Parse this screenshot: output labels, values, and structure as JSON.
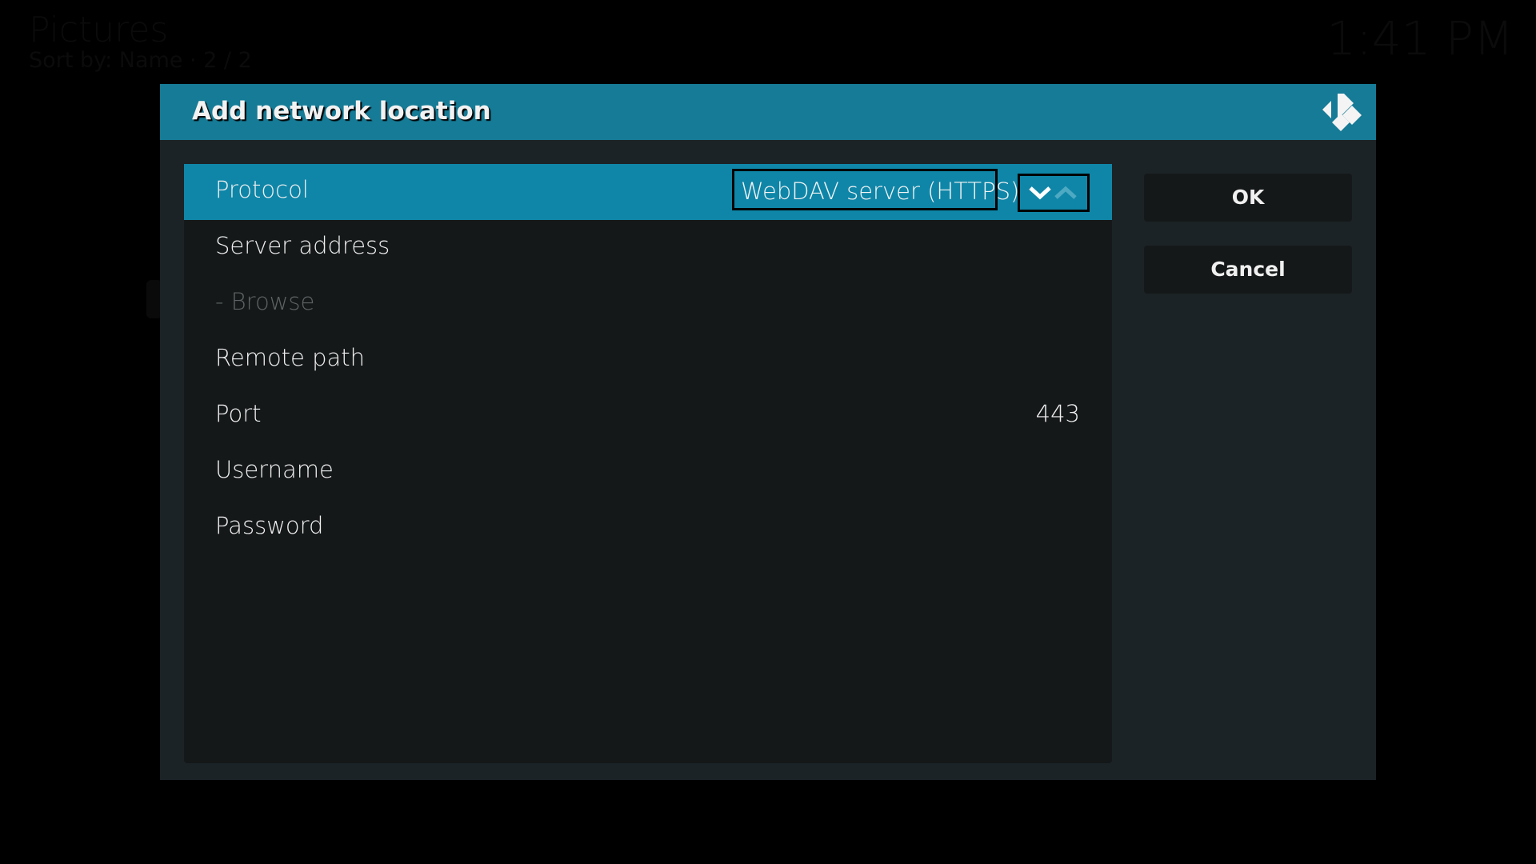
{
  "background": {
    "section_title": "Pictures",
    "sort_info": "Sort by: Name  ·  2 / 2",
    "clock": "1:41 PM"
  },
  "dialog": {
    "title": "Add network location",
    "logo_icon": "kodi-logo-icon",
    "colors": {
      "header": "#167b96",
      "focused_row": "#0f86a8",
      "dialog_bg": "#1c2326",
      "panel_bg": "#151819"
    },
    "settings": [
      {
        "label": "Protocol",
        "value": "WebDAV server (HTTPS)",
        "type": "spinner",
        "focused": true
      },
      {
        "label": "Server address",
        "value": "",
        "type": "text"
      },
      {
        "label": "- Browse",
        "value": "",
        "type": "action",
        "disabled": true
      },
      {
        "label": "Remote path",
        "value": "",
        "type": "text"
      },
      {
        "label": "Port",
        "value": "443",
        "type": "number"
      },
      {
        "label": "Username",
        "value": "",
        "type": "text"
      },
      {
        "label": "Password",
        "value": "",
        "type": "password"
      }
    ],
    "buttons": {
      "ok": "OK",
      "cancel": "Cancel"
    }
  }
}
